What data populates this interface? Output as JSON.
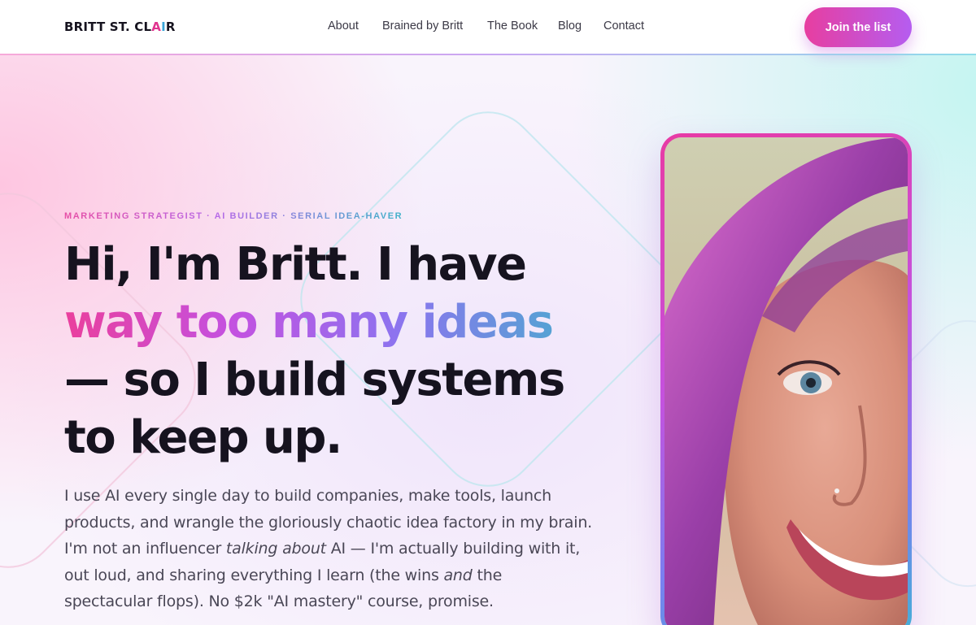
{
  "header": {
    "logo": {
      "prefix": "BRITT ST. CL",
      "a": "A",
      "i": "I",
      "suffix": "R"
    },
    "nav": [
      {
        "label": "About"
      },
      {
        "label": "Brained by Britt"
      },
      {
        "label": "The Book"
      },
      {
        "label": "Blog"
      },
      {
        "label": "Contact"
      }
    ],
    "cta_label": "Join the list"
  },
  "hero": {
    "eyebrow": "MARKETING STRATEGIST · AI BUILDER · SERIAL IDEA-HAVER",
    "headline": {
      "line1": "Hi, I'm Britt. I have",
      "line2_highlight": "way too many ideas",
      "line3": "— so I build systems",
      "line4": "to keep up."
    },
    "body": {
      "part1": "I use AI every single day to build companies, make tools, launch products, and wrangle the gloriously chaotic idea factory in my brain. I'm not an influencer ",
      "em1": "talking about",
      "part2": " AI — I'm actually building with it, out loud, and sharing everything I learn (the wins ",
      "em2": "and",
      "part3": " the spectacular flops). No $2k \"AI mastery\" course, promise."
    }
  },
  "colors": {
    "ink": "#16131f",
    "pink": "#e73ea0",
    "purple": "#b55df0",
    "teal": "#3fb5c9"
  },
  "icons": {
    "photo": "portrait-photo"
  }
}
